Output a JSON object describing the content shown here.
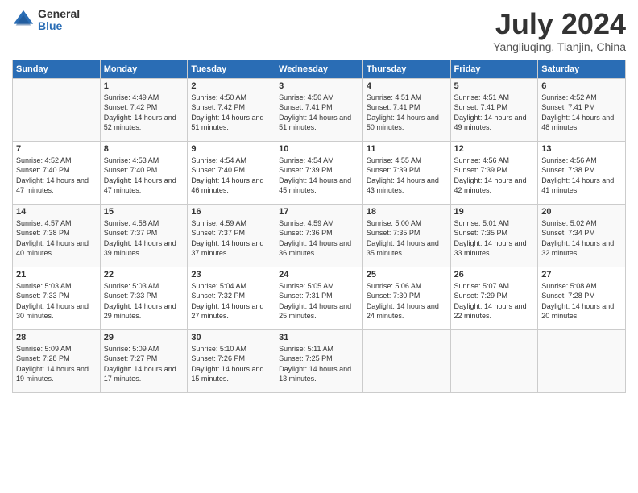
{
  "logo": {
    "general": "General",
    "blue": "Blue"
  },
  "title": "July 2024",
  "location": "Yangliuqing, Tianjin, China",
  "weekdays": [
    "Sunday",
    "Monday",
    "Tuesday",
    "Wednesday",
    "Thursday",
    "Friday",
    "Saturday"
  ],
  "weeks": [
    [
      {
        "day": "",
        "sunrise": "",
        "sunset": "",
        "daylight": ""
      },
      {
        "day": "1",
        "sunrise": "Sunrise: 4:49 AM",
        "sunset": "Sunset: 7:42 PM",
        "daylight": "Daylight: 14 hours and 52 minutes."
      },
      {
        "day": "2",
        "sunrise": "Sunrise: 4:50 AM",
        "sunset": "Sunset: 7:42 PM",
        "daylight": "Daylight: 14 hours and 51 minutes."
      },
      {
        "day": "3",
        "sunrise": "Sunrise: 4:50 AM",
        "sunset": "Sunset: 7:41 PM",
        "daylight": "Daylight: 14 hours and 51 minutes."
      },
      {
        "day": "4",
        "sunrise": "Sunrise: 4:51 AM",
        "sunset": "Sunset: 7:41 PM",
        "daylight": "Daylight: 14 hours and 50 minutes."
      },
      {
        "day": "5",
        "sunrise": "Sunrise: 4:51 AM",
        "sunset": "Sunset: 7:41 PM",
        "daylight": "Daylight: 14 hours and 49 minutes."
      },
      {
        "day": "6",
        "sunrise": "Sunrise: 4:52 AM",
        "sunset": "Sunset: 7:41 PM",
        "daylight": "Daylight: 14 hours and 48 minutes."
      }
    ],
    [
      {
        "day": "7",
        "sunrise": "Sunrise: 4:52 AM",
        "sunset": "Sunset: 7:40 PM",
        "daylight": "Daylight: 14 hours and 47 minutes."
      },
      {
        "day": "8",
        "sunrise": "Sunrise: 4:53 AM",
        "sunset": "Sunset: 7:40 PM",
        "daylight": "Daylight: 14 hours and 47 minutes."
      },
      {
        "day": "9",
        "sunrise": "Sunrise: 4:54 AM",
        "sunset": "Sunset: 7:40 PM",
        "daylight": "Daylight: 14 hours and 46 minutes."
      },
      {
        "day": "10",
        "sunrise": "Sunrise: 4:54 AM",
        "sunset": "Sunset: 7:39 PM",
        "daylight": "Daylight: 14 hours and 45 minutes."
      },
      {
        "day": "11",
        "sunrise": "Sunrise: 4:55 AM",
        "sunset": "Sunset: 7:39 PM",
        "daylight": "Daylight: 14 hours and 43 minutes."
      },
      {
        "day": "12",
        "sunrise": "Sunrise: 4:56 AM",
        "sunset": "Sunset: 7:39 PM",
        "daylight": "Daylight: 14 hours and 42 minutes."
      },
      {
        "day": "13",
        "sunrise": "Sunrise: 4:56 AM",
        "sunset": "Sunset: 7:38 PM",
        "daylight": "Daylight: 14 hours and 41 minutes."
      }
    ],
    [
      {
        "day": "14",
        "sunrise": "Sunrise: 4:57 AM",
        "sunset": "Sunset: 7:38 PM",
        "daylight": "Daylight: 14 hours and 40 minutes."
      },
      {
        "day": "15",
        "sunrise": "Sunrise: 4:58 AM",
        "sunset": "Sunset: 7:37 PM",
        "daylight": "Daylight: 14 hours and 39 minutes."
      },
      {
        "day": "16",
        "sunrise": "Sunrise: 4:59 AM",
        "sunset": "Sunset: 7:37 PM",
        "daylight": "Daylight: 14 hours and 37 minutes."
      },
      {
        "day": "17",
        "sunrise": "Sunrise: 4:59 AM",
        "sunset": "Sunset: 7:36 PM",
        "daylight": "Daylight: 14 hours and 36 minutes."
      },
      {
        "day": "18",
        "sunrise": "Sunrise: 5:00 AM",
        "sunset": "Sunset: 7:35 PM",
        "daylight": "Daylight: 14 hours and 35 minutes."
      },
      {
        "day": "19",
        "sunrise": "Sunrise: 5:01 AM",
        "sunset": "Sunset: 7:35 PM",
        "daylight": "Daylight: 14 hours and 33 minutes."
      },
      {
        "day": "20",
        "sunrise": "Sunrise: 5:02 AM",
        "sunset": "Sunset: 7:34 PM",
        "daylight": "Daylight: 14 hours and 32 minutes."
      }
    ],
    [
      {
        "day": "21",
        "sunrise": "Sunrise: 5:03 AM",
        "sunset": "Sunset: 7:33 PM",
        "daylight": "Daylight: 14 hours and 30 minutes."
      },
      {
        "day": "22",
        "sunrise": "Sunrise: 5:03 AM",
        "sunset": "Sunset: 7:33 PM",
        "daylight": "Daylight: 14 hours and 29 minutes."
      },
      {
        "day": "23",
        "sunrise": "Sunrise: 5:04 AM",
        "sunset": "Sunset: 7:32 PM",
        "daylight": "Daylight: 14 hours and 27 minutes."
      },
      {
        "day": "24",
        "sunrise": "Sunrise: 5:05 AM",
        "sunset": "Sunset: 7:31 PM",
        "daylight": "Daylight: 14 hours and 25 minutes."
      },
      {
        "day": "25",
        "sunrise": "Sunrise: 5:06 AM",
        "sunset": "Sunset: 7:30 PM",
        "daylight": "Daylight: 14 hours and 24 minutes."
      },
      {
        "day": "26",
        "sunrise": "Sunrise: 5:07 AM",
        "sunset": "Sunset: 7:29 PM",
        "daylight": "Daylight: 14 hours and 22 minutes."
      },
      {
        "day": "27",
        "sunrise": "Sunrise: 5:08 AM",
        "sunset": "Sunset: 7:28 PM",
        "daylight": "Daylight: 14 hours and 20 minutes."
      }
    ],
    [
      {
        "day": "28",
        "sunrise": "Sunrise: 5:09 AM",
        "sunset": "Sunset: 7:28 PM",
        "daylight": "Daylight: 14 hours and 19 minutes."
      },
      {
        "day": "29",
        "sunrise": "Sunrise: 5:09 AM",
        "sunset": "Sunset: 7:27 PM",
        "daylight": "Daylight: 14 hours and 17 minutes."
      },
      {
        "day": "30",
        "sunrise": "Sunrise: 5:10 AM",
        "sunset": "Sunset: 7:26 PM",
        "daylight": "Daylight: 14 hours and 15 minutes."
      },
      {
        "day": "31",
        "sunrise": "Sunrise: 5:11 AM",
        "sunset": "Sunset: 7:25 PM",
        "daylight": "Daylight: 14 hours and 13 minutes."
      },
      {
        "day": "",
        "sunrise": "",
        "sunset": "",
        "daylight": ""
      },
      {
        "day": "",
        "sunrise": "",
        "sunset": "",
        "daylight": ""
      },
      {
        "day": "",
        "sunrise": "",
        "sunset": "",
        "daylight": ""
      }
    ]
  ]
}
